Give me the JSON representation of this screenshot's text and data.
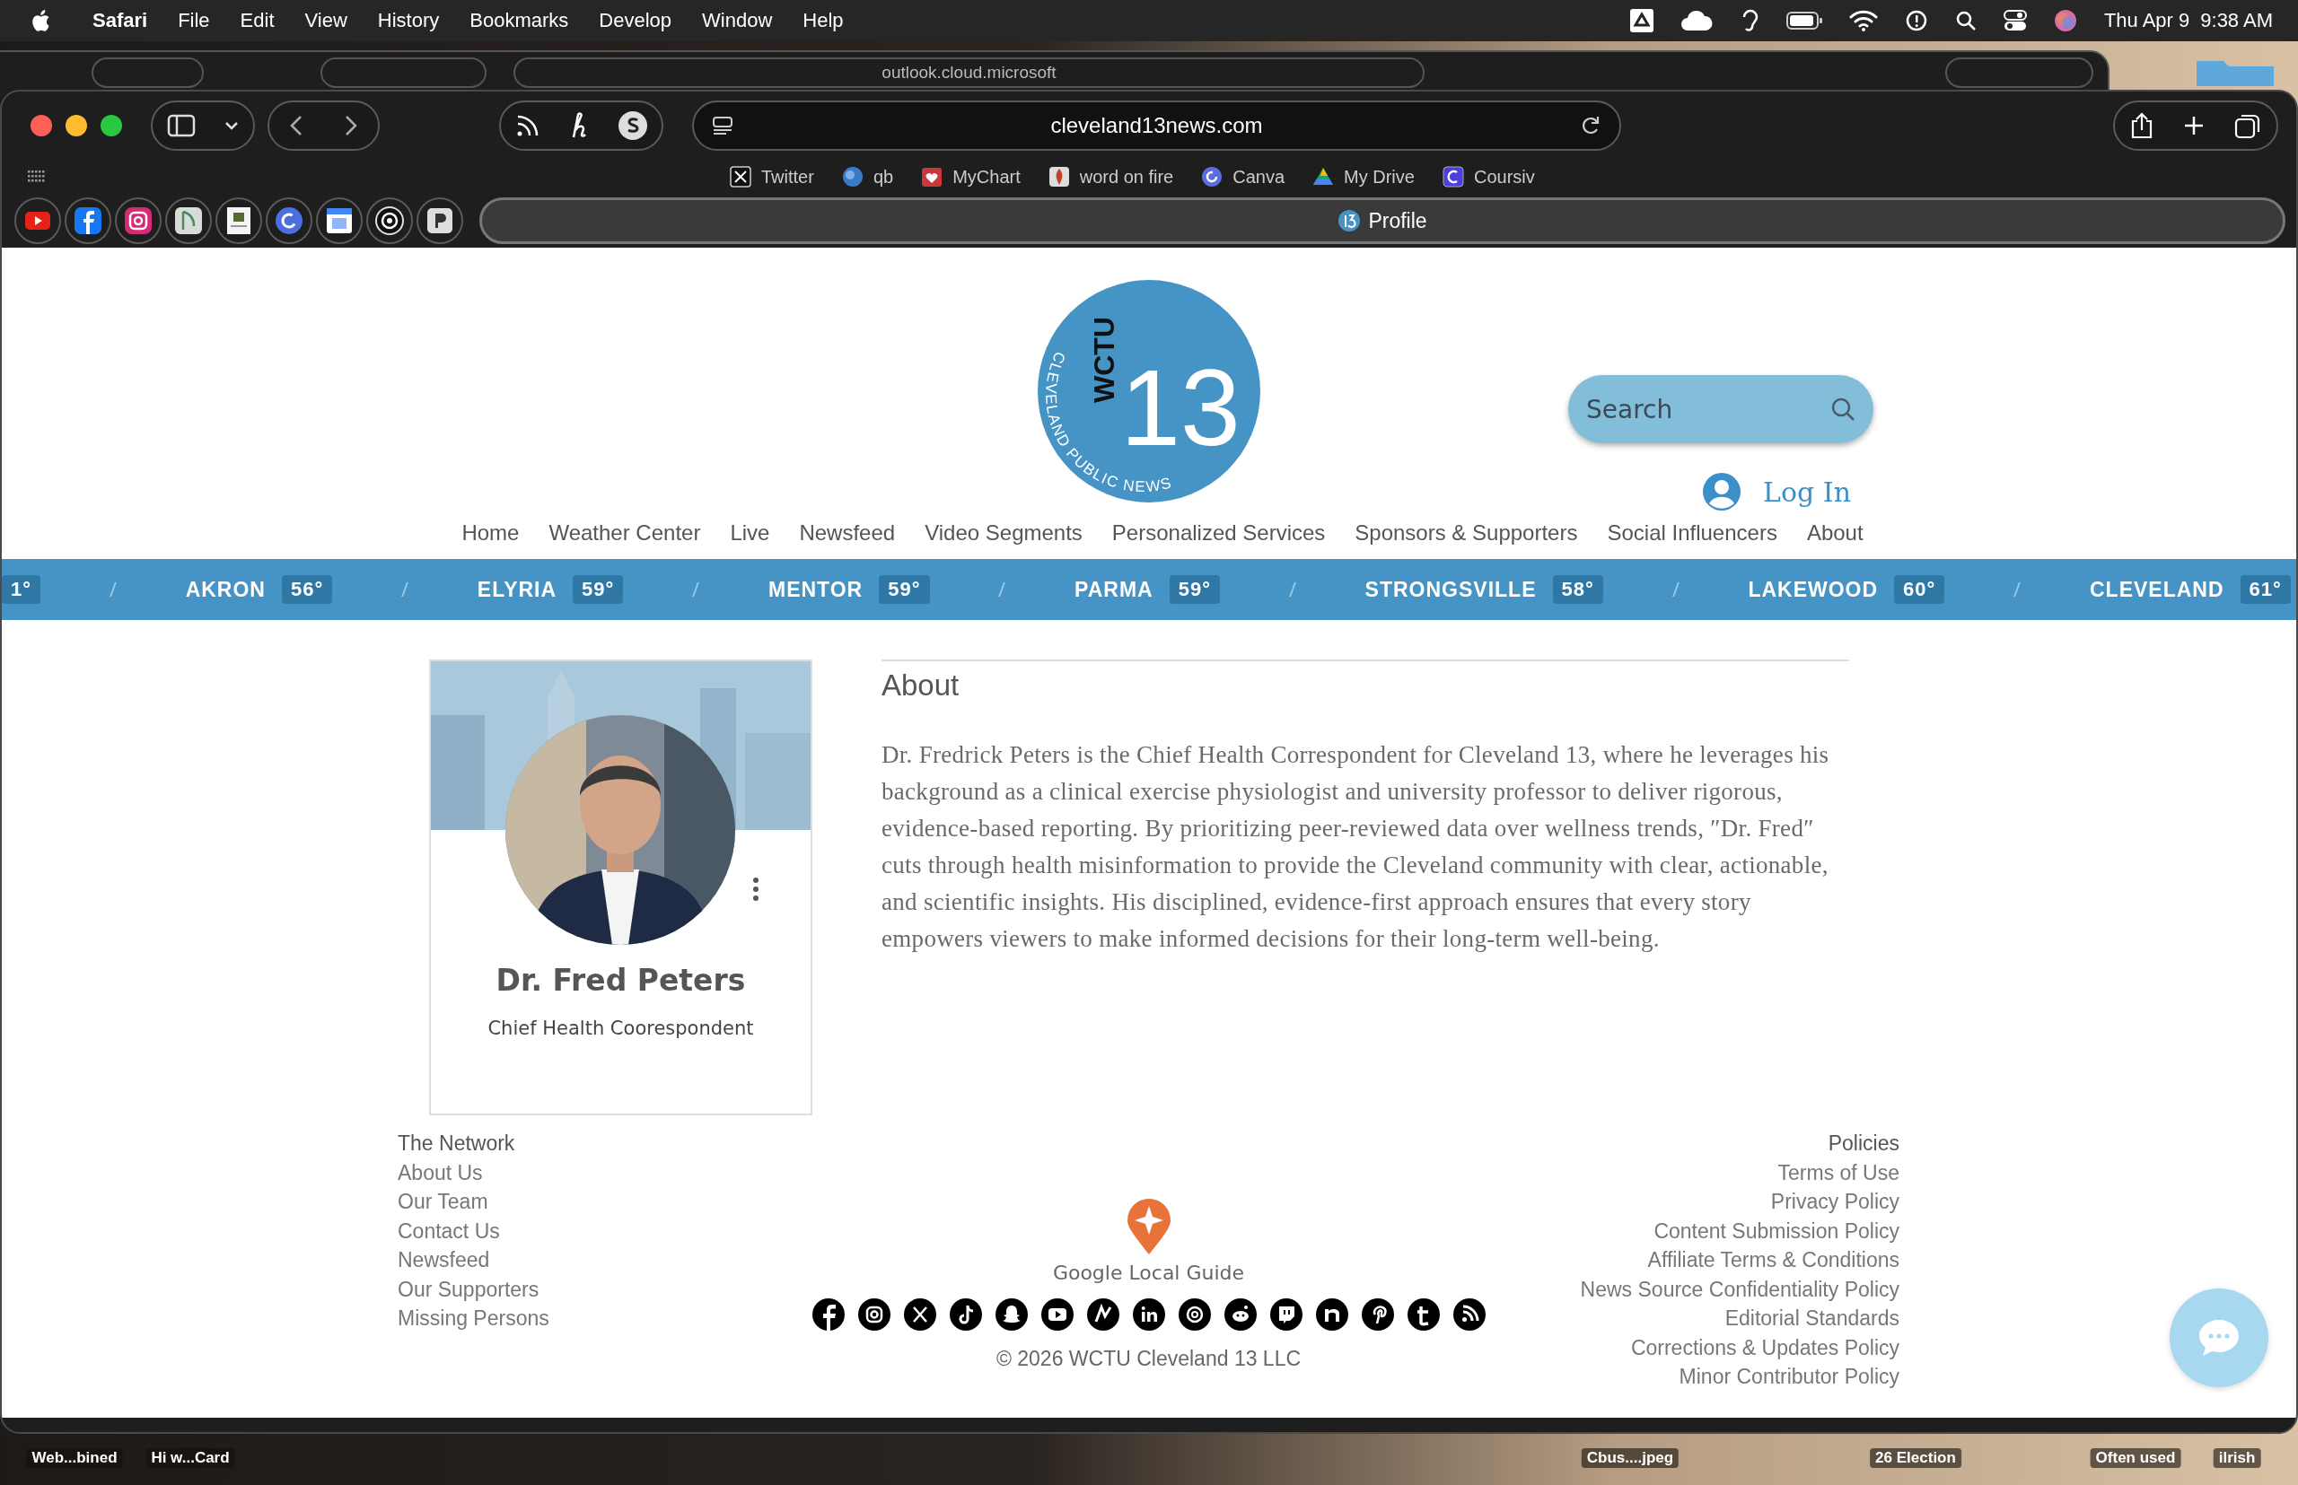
{
  "menu_bar": {
    "app": "Safari",
    "menus": [
      "File",
      "Edit",
      "View",
      "History",
      "Bookmarks",
      "Develop",
      "Window",
      "Help"
    ],
    "date": "Thu Apr 9",
    "time": "9:38 AM"
  },
  "back_window": {
    "address": "outlook.cloud.microsoft"
  },
  "browser": {
    "address": "cleveland13news.com",
    "bookmarks": [
      "Twitter",
      "qb",
      "MyChart",
      "word on fire",
      "Canva",
      "My Drive",
      "Coursiv"
    ],
    "active_tab": {
      "title": "Profile"
    }
  },
  "site": {
    "logo": {
      "callsign": "WCTU",
      "number": "13",
      "tagline": "CLEVELAND PUBLIC NEWS"
    },
    "search": {
      "placeholder": "Search"
    },
    "login": "Log In",
    "nav": [
      "Home",
      "Weather Center",
      "Live",
      "Newsfeed",
      "Video Segments",
      "Personalized Services",
      "Sponsors & Supporters",
      "Social Influencers",
      "About"
    ],
    "ticker": [
      {
        "temp": "1°"
      },
      {
        "city": "AKRON",
        "temp": "56°"
      },
      {
        "city": "ELYRIA",
        "temp": "59°"
      },
      {
        "city": "MENTOR",
        "temp": "59°"
      },
      {
        "city": "PARMA",
        "temp": "59°"
      },
      {
        "city": "STRONGSVILLE",
        "temp": "58°"
      },
      {
        "city": "LAKEWOOD",
        "temp": "60°"
      },
      {
        "city": "CLEVELAND",
        "temp": "61°"
      }
    ],
    "profile": {
      "name": "Dr. Fred Peters",
      "title": "Chief Health Coorespondent"
    },
    "about": {
      "heading": "About",
      "text": "Dr. Fredrick Peters is the Chief Health Correspondent for Cleveland 13, where he leverages his background as a clinical exercise physiologist and university professor to deliver rigorous, evidence-based reporting. By prioritizing peer-reviewed data over wellness trends, ″Dr. Fred″ cuts through health misinformation to provide the Cleveland community with clear, actionable, and scientific insights. His disciplined, evidence-first approach ensures that every story empowers viewers to make informed decisions for their long-term well-being."
    },
    "footer": {
      "network": {
        "title": "The Network",
        "links": [
          "About Us",
          "Our Team",
          "Contact Us",
          "Newsfeed",
          "Our Supporters",
          "Missing Persons"
        ]
      },
      "badge": "Google Local Guide",
      "copyright": "© 2026 WCTU Cleveland 13 LLC",
      "policies": {
        "title": "Policies",
        "links": [
          "Terms of Use",
          "Privacy Policy",
          "Content Submission Policy",
          "Affiliate Terms & Conditions",
          "News Source Confidentiality Policy",
          "Editorial Standards",
          "Corrections & Updates Policy",
          "Minor Contributor Policy"
        ]
      }
    }
  },
  "desktop_items": [
    "Web...bined",
    "Hi w...Card",
    "Cbus....jpeg",
    "26 Election",
    "Often used",
    "ilrish"
  ]
}
